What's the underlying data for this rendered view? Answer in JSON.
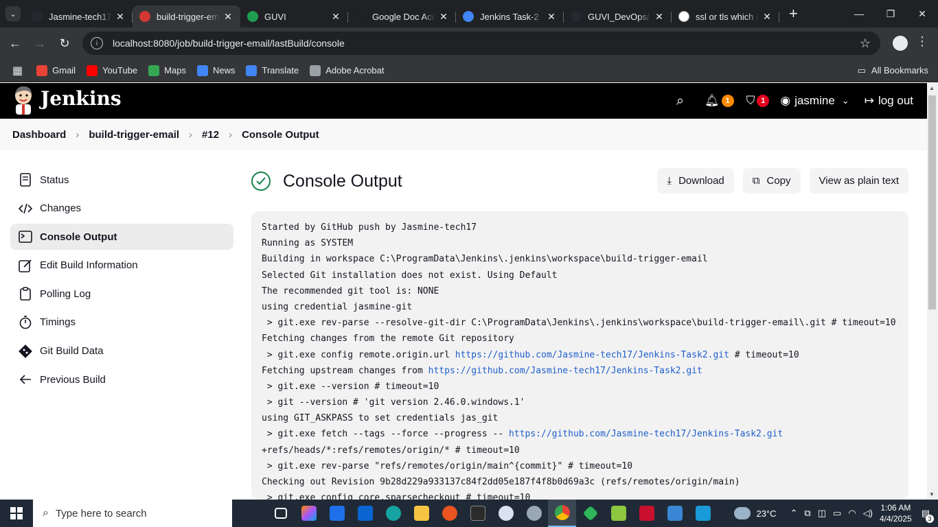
{
  "browser": {
    "tabs": [
      {
        "title": "Jasmine-tech17/",
        "fav_color": "#24292f",
        "active": false
      },
      {
        "title": "build-trigger-em",
        "fav_color": "#d33833",
        "active": true
      },
      {
        "title": "GUVI",
        "fav_color": "#1e9d4f",
        "active": false
      },
      {
        "title": "Google Doc Acc",
        "fav_color": "#202124",
        "active": false
      },
      {
        "title": "Jenkins Task-2 -",
        "fav_color": "#4285f4",
        "active": false
      },
      {
        "title": "GUVI_DevOps/1",
        "fav_color": "#24292f",
        "active": false
      },
      {
        "title": "ssl or tls which i",
        "fav_color": "#ffffff",
        "active": false
      }
    ],
    "url": "localhost:8080/job/build-trigger-email/lastBuild/console",
    "bookmarks": [
      {
        "label": "Gmail",
        "color": "#ea4335"
      },
      {
        "label": "YouTube",
        "color": "#ff0000"
      },
      {
        "label": "Maps",
        "color": "#34a853"
      },
      {
        "label": "News",
        "color": "#4285f4"
      },
      {
        "label": "Translate",
        "color": "#4285f4"
      },
      {
        "label": "Adobe Acrobat",
        "color": "#9aa0a6"
      }
    ],
    "all_bookmarks": "All Bookmarks"
  },
  "jenkins": {
    "brand": "Jenkins",
    "notifications_count": "1",
    "security_count": "1",
    "user": "jasmine",
    "logout": "log out"
  },
  "breadcrumb": [
    "Dashboard",
    "build-trigger-email",
    "#12",
    "Console Output"
  ],
  "sidebar": [
    {
      "label": "Status",
      "icon": "document-icon",
      "active": false
    },
    {
      "label": "Changes",
      "icon": "code-icon",
      "active": false
    },
    {
      "label": "Console Output",
      "icon": "terminal-icon",
      "active": true
    },
    {
      "label": "Edit Build Information",
      "icon": "edit-icon",
      "active": false
    },
    {
      "label": "Polling Log",
      "icon": "clipboard-icon",
      "active": false
    },
    {
      "label": "Timings",
      "icon": "stopwatch-icon",
      "active": false
    },
    {
      "label": "Git Build Data",
      "icon": "git-icon",
      "active": false
    },
    {
      "label": "Previous Build",
      "icon": "arrow-left-icon",
      "active": false
    }
  ],
  "page": {
    "title": "Console Output",
    "download": "Download",
    "copy": "Copy",
    "plain_text": "View as plain text"
  },
  "console": [
    {
      "text": "Started by GitHub push by Jasmine-tech17"
    },
    {
      "text": "Running as SYSTEM"
    },
    {
      "text": "Building in workspace C:\\ProgramData\\Jenkins\\.jenkins\\workspace\\build-trigger-email"
    },
    {
      "text": "Selected Git installation does not exist. Using Default"
    },
    {
      "text": "The recommended git tool is: NONE"
    },
    {
      "text": "using credential jasmine-git"
    },
    {
      "text": " > git.exe rev-parse --resolve-git-dir C:\\ProgramData\\Jenkins\\.jenkins\\workspace\\build-trigger-email\\.git # timeout=10"
    },
    {
      "text": "Fetching changes from the remote Git repository"
    },
    {
      "text": " > git.exe config remote.origin.url ",
      "link": "https://github.com/Jasmine-tech17/Jenkins-Task2.git",
      "after": " # timeout=10"
    },
    {
      "text": "Fetching upstream changes from ",
      "link": "https://github.com/Jasmine-tech17/Jenkins-Task2.git",
      "after": ""
    },
    {
      "text": " > git.exe --version # timeout=10"
    },
    {
      "text": " > git --version # 'git version 2.46.0.windows.1'"
    },
    {
      "text": "using GIT_ASKPASS to set credentials jas_git"
    },
    {
      "text": " > git.exe fetch --tags --force --progress -- ",
      "link": "https://github.com/Jasmine-tech17/Jenkins-Task2.git",
      "after": ""
    },
    {
      "text": "+refs/heads/*:refs/remotes/origin/* # timeout=10"
    },
    {
      "text": " > git.exe rev-parse \"refs/remotes/origin/main^{commit}\" # timeout=10"
    },
    {
      "text": "Checking out Revision 9b28d229a933137c84f2dd05e187f4f8b0d69a3c (refs/remotes/origin/main)"
    },
    {
      "text": " > git.exe config core.sparsecheckout # timeout=10"
    }
  ],
  "taskbar": {
    "search_placeholder": "Type here to search",
    "weather": "23°C",
    "time": "1:06 AM",
    "date": "4/4/2025",
    "notif_count": "3"
  }
}
